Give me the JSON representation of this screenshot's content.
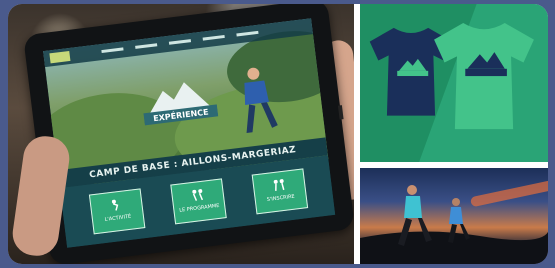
{
  "tablet_site": {
    "banner_text": "CAMP DE BASE : AILLONS-MARGERIAZ",
    "buttons": [
      {
        "label": "L'ACTIVITÉ"
      },
      {
        "label": "LE PROGRAMME"
      },
      {
        "label": "S'INSCRIRE"
      }
    ],
    "hero_badge_text": "EXPÉRIENCE",
    "colors": {
      "site_dark": "#153f48",
      "button_green": "#2faa79",
      "shirt_navy": "#1a2f5a",
      "shirt_green": "#43c38a"
    }
  },
  "shirts_panel": {
    "icons": [
      "navy-tshirt-icon",
      "green-tshirt-icon"
    ]
  },
  "runners_panel": {
    "icons": [
      "runner-woman-icon",
      "runner-man-icon"
    ]
  }
}
